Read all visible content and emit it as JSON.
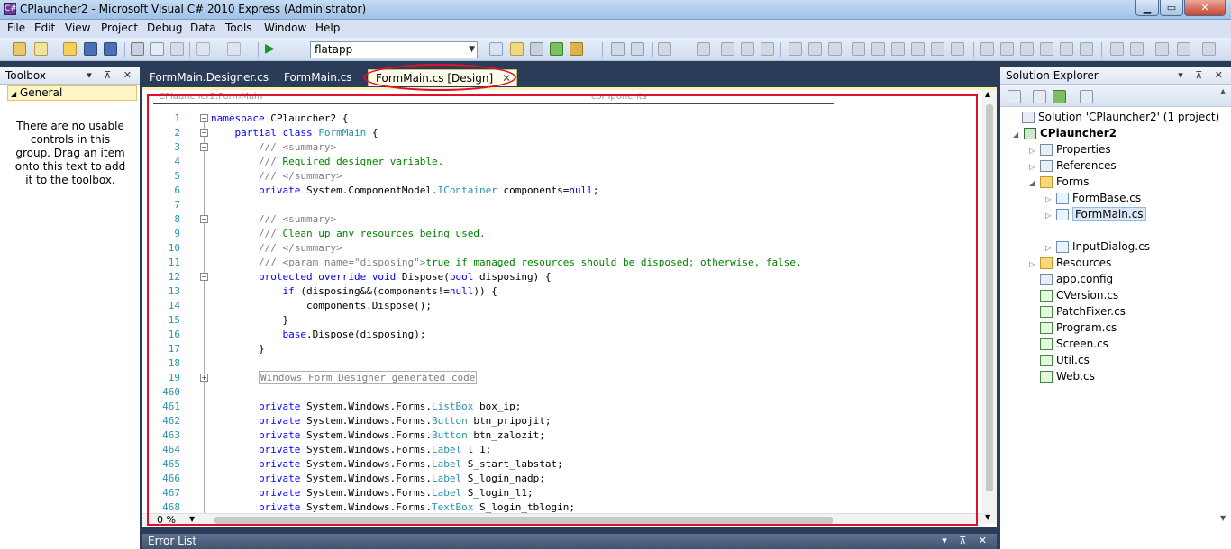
{
  "window": {
    "title": "CPlauncher2 - Microsoft Visual C# 2010 Express (Administrator)",
    "min_glyph": "▁",
    "max_glyph": "▭",
    "close_glyph": "✕"
  },
  "menu": [
    "File",
    "Edit",
    "View",
    "Project",
    "Debug",
    "Data",
    "Tools",
    "Window",
    "Help"
  ],
  "toolbar": {
    "config_value": "flatapp",
    "icons": [
      "new-project-icon",
      "add-item-icon",
      "open-icon",
      "save-icon",
      "save-all-icon",
      "cut-icon",
      "copy-icon",
      "paste-icon",
      "undo-icon",
      "redo-icon",
      "start-debug-icon"
    ]
  },
  "toolbox": {
    "title": "Toolbox",
    "group": "General",
    "message": "There are no usable controls in this group. Drag an item onto this text to add it to the toolbox."
  },
  "tabs": [
    {
      "label": "FormMain.Designer.cs"
    },
    {
      "label": "FormMain.cs"
    },
    {
      "label": "FormMain.cs [Design]"
    }
  ],
  "editor": {
    "nav_left": "CPlauncher2.FormMain",
    "nav_right": "components",
    "zoom": "0 %",
    "line_numbers": [
      "1",
      "2",
      "3",
      "4",
      "5",
      "6",
      "7",
      "8",
      "9",
      "10",
      "11",
      "12",
      "13",
      "14",
      "15",
      "16",
      "17",
      "18",
      "19",
      "460",
      "461",
      "462",
      "463",
      "464",
      "465",
      "466",
      "467",
      "468"
    ],
    "code": [
      [
        {
          "c": "kw",
          "t": "namespace"
        },
        {
          "c": "",
          "t": " CPlauncher2 {"
        }
      ],
      [
        {
          "c": "",
          "t": "    "
        },
        {
          "c": "kw",
          "t": "partial class"
        },
        {
          "c": "",
          "t": " "
        },
        {
          "c": "ty",
          "t": "FormMain"
        },
        {
          "c": "",
          "t": " {"
        }
      ],
      [
        {
          "c": "",
          "t": "        "
        },
        {
          "c": "cmg",
          "t": "/// <summary>"
        }
      ],
      [
        {
          "c": "",
          "t": "        "
        },
        {
          "c": "cmg",
          "t": "///"
        },
        {
          "c": "cm",
          "t": " Required designer variable."
        }
      ],
      [
        {
          "c": "",
          "t": "        "
        },
        {
          "c": "cmg",
          "t": "/// </summary>"
        }
      ],
      [
        {
          "c": "",
          "t": "        "
        },
        {
          "c": "kw",
          "t": "private"
        },
        {
          "c": "",
          "t": " System.ComponentModel."
        },
        {
          "c": "ty",
          "t": "IContainer"
        },
        {
          "c": "",
          "t": " components="
        },
        {
          "c": "kw",
          "t": "null"
        },
        {
          "c": "",
          "t": ";"
        }
      ],
      [
        {
          "c": "",
          "t": ""
        }
      ],
      [
        {
          "c": "",
          "t": "        "
        },
        {
          "c": "cmg",
          "t": "/// <summary>"
        }
      ],
      [
        {
          "c": "",
          "t": "        "
        },
        {
          "c": "cmg",
          "t": "///"
        },
        {
          "c": "cm",
          "t": " Clean up any resources being used."
        }
      ],
      [
        {
          "c": "",
          "t": "        "
        },
        {
          "c": "cmg",
          "t": "/// </summary>"
        }
      ],
      [
        {
          "c": "",
          "t": "        "
        },
        {
          "c": "cmg",
          "t": "/// <param name=\"disposing\">"
        },
        {
          "c": "cm",
          "t": "true if managed resources should be disposed; otherwise, false."
        }
      ],
      [
        {
          "c": "",
          "t": "        "
        },
        {
          "c": "kw",
          "t": "protected override void"
        },
        {
          "c": "",
          "t": " Dispose("
        },
        {
          "c": "kw",
          "t": "bool"
        },
        {
          "c": "",
          "t": " disposing) {"
        }
      ],
      [
        {
          "c": "",
          "t": "            "
        },
        {
          "c": "kw",
          "t": "if"
        },
        {
          "c": "",
          "t": " (disposing&&(components!="
        },
        {
          "c": "kw",
          "t": "null"
        },
        {
          "c": "",
          "t": ")) {"
        }
      ],
      [
        {
          "c": "",
          "t": "                components.Dispose();"
        }
      ],
      [
        {
          "c": "",
          "t": "            }"
        }
      ],
      [
        {
          "c": "",
          "t": "            "
        },
        {
          "c": "kw",
          "t": "base"
        },
        {
          "c": "",
          "t": ".Dispose(disposing);"
        }
      ],
      [
        {
          "c": "",
          "t": "        }"
        }
      ],
      [
        {
          "c": "",
          "t": ""
        }
      ],
      [
        {
          "c": "",
          "t": "        "
        },
        {
          "c": "region",
          "t": "Windows Form Designer generated code"
        }
      ],
      [
        {
          "c": "",
          "t": ""
        }
      ],
      [
        {
          "c": "",
          "t": "        "
        },
        {
          "c": "kw",
          "t": "private"
        },
        {
          "c": "",
          "t": " System.Windows.Forms."
        },
        {
          "c": "ty",
          "t": "ListBox"
        },
        {
          "c": "",
          "t": " box_ip;"
        }
      ],
      [
        {
          "c": "",
          "t": "        "
        },
        {
          "c": "kw",
          "t": "private"
        },
        {
          "c": "",
          "t": " System.Windows.Forms."
        },
        {
          "c": "ty",
          "t": "Button"
        },
        {
          "c": "",
          "t": " btn_pripojit;"
        }
      ],
      [
        {
          "c": "",
          "t": "        "
        },
        {
          "c": "kw",
          "t": "private"
        },
        {
          "c": "",
          "t": " System.Windows.Forms."
        },
        {
          "c": "ty",
          "t": "Button"
        },
        {
          "c": "",
          "t": " btn_zalozit;"
        }
      ],
      [
        {
          "c": "",
          "t": "        "
        },
        {
          "c": "kw",
          "t": "private"
        },
        {
          "c": "",
          "t": " System.Windows.Forms."
        },
        {
          "c": "ty",
          "t": "Label"
        },
        {
          "c": "",
          "t": " l_1;"
        }
      ],
      [
        {
          "c": "",
          "t": "        "
        },
        {
          "c": "kw",
          "t": "private"
        },
        {
          "c": "",
          "t": " System.Windows.Forms."
        },
        {
          "c": "ty",
          "t": "Label"
        },
        {
          "c": "",
          "t": " S_start_labstat;"
        }
      ],
      [
        {
          "c": "",
          "t": "        "
        },
        {
          "c": "kw",
          "t": "private"
        },
        {
          "c": "",
          "t": " System.Windows.Forms."
        },
        {
          "c": "ty",
          "t": "Label"
        },
        {
          "c": "",
          "t": " S_login_nadp;"
        }
      ],
      [
        {
          "c": "",
          "t": "        "
        },
        {
          "c": "kw",
          "t": "private"
        },
        {
          "c": "",
          "t": " System.Windows.Forms."
        },
        {
          "c": "ty",
          "t": "Label"
        },
        {
          "c": "",
          "t": " S_login_l1;"
        }
      ],
      [
        {
          "c": "",
          "t": "        "
        },
        {
          "c": "kw",
          "t": "private"
        },
        {
          "c": "",
          "t": " System.Windows.Forms."
        },
        {
          "c": "ty",
          "t": "TextBox"
        },
        {
          "c": "",
          "t": " S_login_tblogin;"
        }
      ]
    ],
    "fold_rows": [
      {
        "row": 0,
        "g": "−"
      },
      {
        "row": 1,
        "g": "−"
      },
      {
        "row": 2,
        "g": "−"
      },
      {
        "row": 7,
        "g": "−"
      },
      {
        "row": 11,
        "g": "−"
      },
      {
        "row": 18,
        "g": "+"
      }
    ]
  },
  "error_list": {
    "title": "Error List"
  },
  "solution_explorer": {
    "title": "Solution Explorer",
    "items": [
      {
        "label": "Solution 'CPlauncher2' (1 project)",
        "icon": "solution-icon",
        "arrow": ""
      },
      {
        "label": "CPlauncher2",
        "icon": "project-icon",
        "arrow": "◢",
        "bold": true
      },
      {
        "label": "Properties",
        "icon": "properties-icon",
        "arrow": "▷"
      },
      {
        "label": "References",
        "icon": "references-icon",
        "arrow": "▷"
      },
      {
        "label": "Forms",
        "icon": "folder-icon",
        "arrow": "◢"
      },
      {
        "label": "FormBase.cs",
        "icon": "form-icon",
        "arrow": "▷"
      },
      {
        "label": "FormMain.cs",
        "icon": "form-icon",
        "arrow": "▷",
        "selected": true
      },
      {
        "label": "",
        "icon": "",
        "arrow": ""
      },
      {
        "label": "InputDialog.cs",
        "icon": "form-icon",
        "arrow": "▷"
      },
      {
        "label": "Resources",
        "icon": "folder-icon",
        "arrow": "▷"
      },
      {
        "label": "app.config",
        "icon": "config-icon",
        "arrow": ""
      },
      {
        "label": "CVersion.cs",
        "icon": "cs-file-icon",
        "arrow": ""
      },
      {
        "label": "PatchFixer.cs",
        "icon": "cs-file-icon",
        "arrow": ""
      },
      {
        "label": "Program.cs",
        "icon": "cs-file-icon",
        "arrow": ""
      },
      {
        "label": "Screen.cs",
        "icon": "cs-file-icon",
        "arrow": ""
      },
      {
        "label": "Util.cs",
        "icon": "cs-file-icon",
        "arrow": ""
      },
      {
        "label": "Web.cs",
        "icon": "cs-file-icon",
        "arrow": ""
      }
    ]
  },
  "panel_buttons": "▾ ⊼ ✕",
  "colors": {
    "annotation": "#e0102a",
    "keyword": "#0000ff",
    "type": "#2b91af",
    "comment": "#008000"
  }
}
